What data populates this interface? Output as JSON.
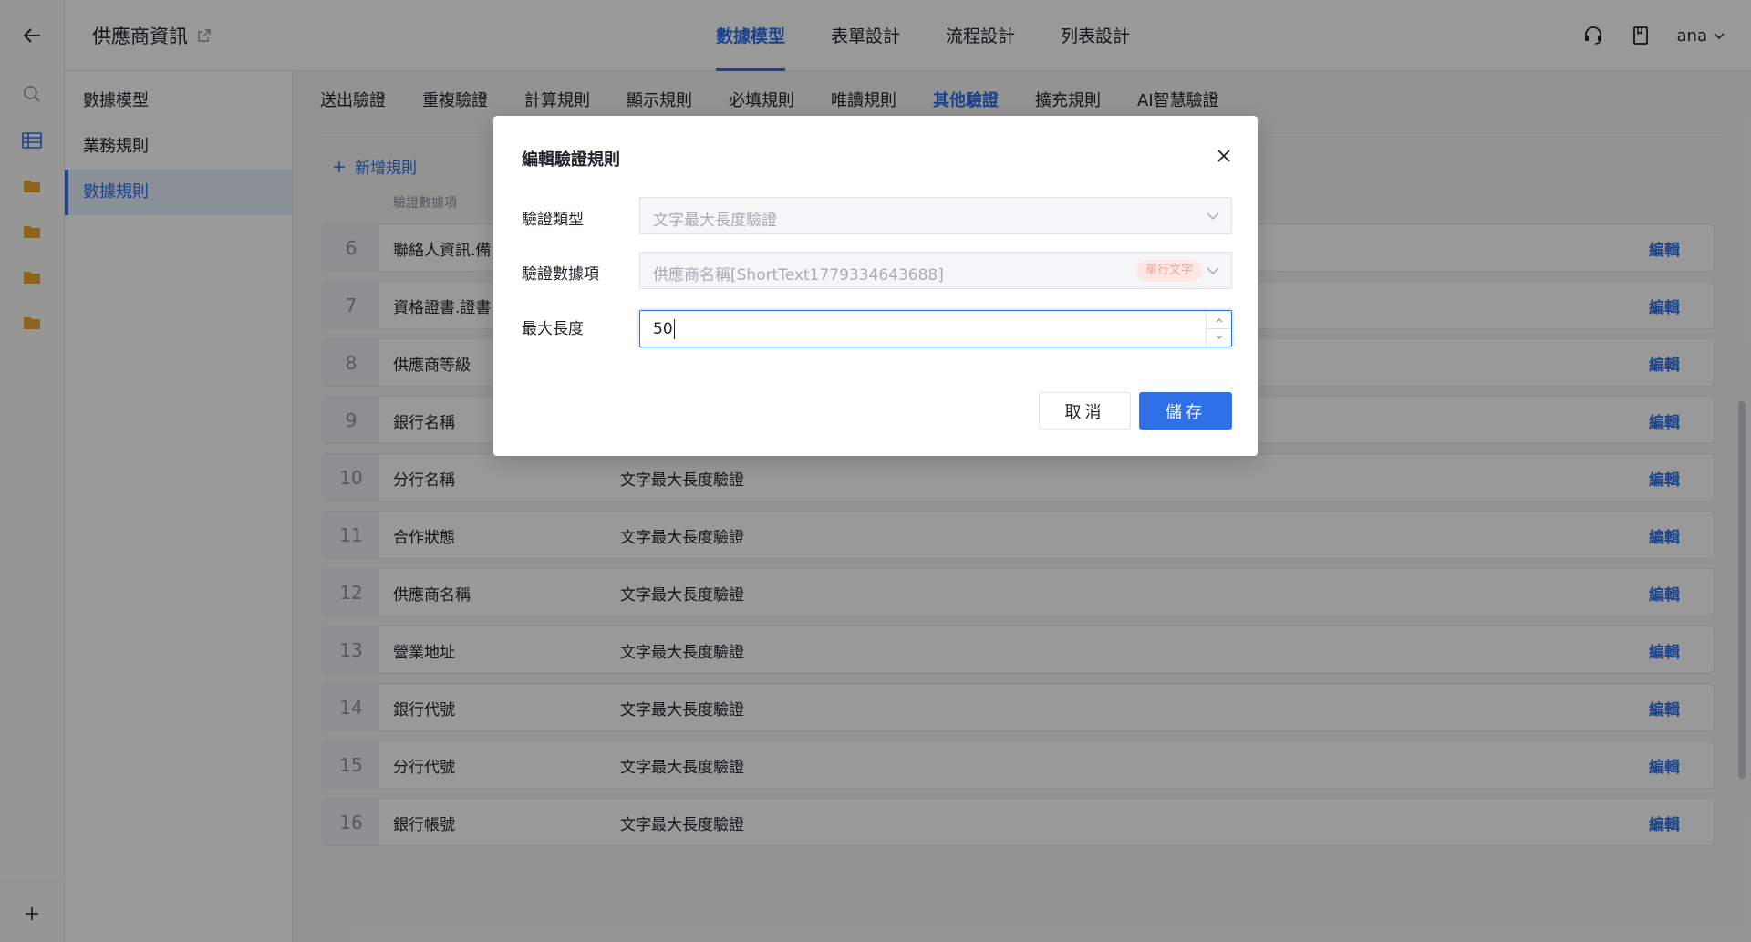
{
  "app": {
    "title": "供應商資訊"
  },
  "main_tabs": [
    {
      "label": "數據模型",
      "active": true
    },
    {
      "label": "表單設計",
      "active": false
    },
    {
      "label": "流程設計",
      "active": false
    },
    {
      "label": "列表設計",
      "active": false
    }
  ],
  "user": {
    "name": "ana"
  },
  "left_nav": [
    {
      "label": "數據模型",
      "active": false
    },
    {
      "label": "業務規則",
      "active": false
    },
    {
      "label": "數據規則",
      "active": true
    }
  ],
  "sub_tabs": [
    {
      "label": "送出驗證"
    },
    {
      "label": "重複驗證"
    },
    {
      "label": "計算規則"
    },
    {
      "label": "顯示規則"
    },
    {
      "label": "必填規則"
    },
    {
      "label": "唯讀規則"
    },
    {
      "label": "其他驗證",
      "active": true
    },
    {
      "label": "擴充規則"
    },
    {
      "label": "AI智慧驗證"
    }
  ],
  "toolbar": {
    "add_rule": "新增規則"
  },
  "table": {
    "header_field": "驗證數據項",
    "edit_label": "編輯",
    "rows": [
      {
        "num": "6",
        "field": "聯絡人資訊.備",
        "type": ""
      },
      {
        "num": "7",
        "field": "資格證書.證書",
        "type": ""
      },
      {
        "num": "8",
        "field": "供應商等級",
        "type": ""
      },
      {
        "num": "9",
        "field": "銀行名稱",
        "type": ""
      },
      {
        "num": "10",
        "field": "分行名稱",
        "type": "文字最大長度驗證"
      },
      {
        "num": "11",
        "field": "合作狀態",
        "type": "文字最大長度驗證"
      },
      {
        "num": "12",
        "field": "供應商名稱",
        "type": "文字最大長度驗證"
      },
      {
        "num": "13",
        "field": "營業地址",
        "type": "文字最大長度驗證"
      },
      {
        "num": "14",
        "field": "銀行代號",
        "type": "文字最大長度驗證"
      },
      {
        "num": "15",
        "field": "分行代號",
        "type": "文字最大長度驗證"
      },
      {
        "num": "16",
        "field": "銀行帳號",
        "type": "文字最大長度驗證"
      }
    ]
  },
  "modal": {
    "title": "編輯驗證規則",
    "type_label": "驗證類型",
    "type_value": "文字最大長度驗證",
    "field_label": "驗證數據項",
    "field_value": "供應商名稱[ShortText1779334643688]",
    "field_tag": "單行文字",
    "max_label": "最大長度",
    "max_value": "50",
    "cancel_label": "取消",
    "save_label": "儲存"
  },
  "colors": {
    "accent": "#2f6fe8",
    "mask": "rgba(0,0,0,0.4)",
    "tag_bg": "#fde7e4"
  }
}
